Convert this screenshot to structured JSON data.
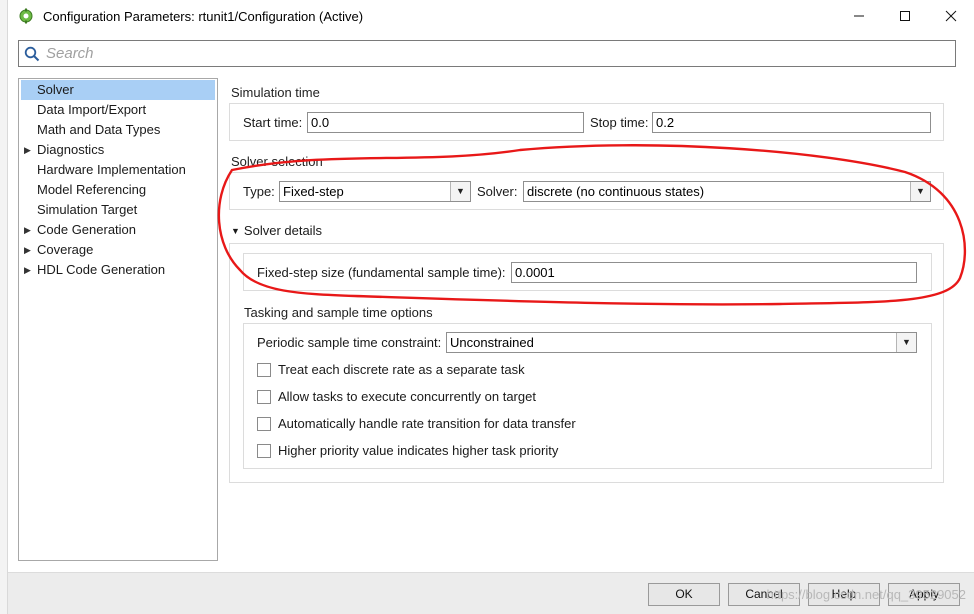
{
  "window": {
    "title": "Configuration Parameters: rtunit1/Configuration (Active)",
    "controls": {
      "minimize": "—",
      "maximize": "☐",
      "close": "✕"
    }
  },
  "search": {
    "placeholder": "Search"
  },
  "nav": {
    "items": [
      {
        "label": "Solver",
        "expandable": false,
        "selected": true
      },
      {
        "label": "Data Import/Export",
        "expandable": false
      },
      {
        "label": "Math and Data Types",
        "expandable": false
      },
      {
        "label": "Diagnostics",
        "expandable": true
      },
      {
        "label": "Hardware Implementation",
        "expandable": false
      },
      {
        "label": "Model Referencing",
        "expandable": false
      },
      {
        "label": "Simulation Target",
        "expandable": false
      },
      {
        "label": "Code Generation",
        "expandable": true
      },
      {
        "label": "Coverage",
        "expandable": true
      },
      {
        "label": "HDL Code Generation",
        "expandable": true
      }
    ]
  },
  "simulation_time": {
    "title": "Simulation time",
    "start_label": "Start time:",
    "start_value": "0.0",
    "stop_label": "Stop time:",
    "stop_value": "0.2"
  },
  "solver_selection": {
    "title": "Solver selection",
    "type_label": "Type:",
    "type_value": "Fixed-step",
    "solver_label": "Solver:",
    "solver_value": "discrete (no continuous states)"
  },
  "solver_details": {
    "title": "Solver details",
    "fixed_step_label": "Fixed-step size (fundamental sample time):",
    "fixed_step_value": "0.0001"
  },
  "tasking": {
    "title": "Tasking and sample time options",
    "constraint_label": "Periodic sample time constraint:",
    "constraint_value": "Unconstrained",
    "checkboxes": [
      {
        "label": "Treat each discrete rate as a separate task",
        "checked": false
      },
      {
        "label": "Allow tasks to execute concurrently on target",
        "checked": false
      },
      {
        "label": "Automatically handle rate transition for data transfer",
        "checked": false
      },
      {
        "label": "Higher priority value indicates higher task priority",
        "checked": false
      }
    ]
  },
  "buttons": {
    "ok": "OK",
    "cancel": "Cancel",
    "help": "Help",
    "apply": "Apply"
  },
  "watermark": "https://blog.csdn.net/qq_39529052",
  "colors": {
    "selection": "#a9cff5",
    "annotation": "#e81818"
  }
}
